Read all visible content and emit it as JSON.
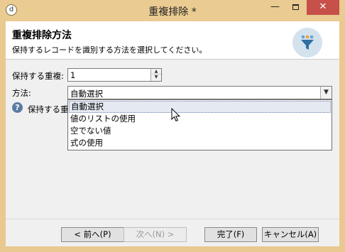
{
  "window": {
    "title": "重複排除 *",
    "app_icon": "d",
    "minimize_glyph": "—",
    "close_glyph": "✕",
    "accent_color": "#eacb91",
    "close_color": "#c7504a"
  },
  "header": {
    "title": "重複排除方法",
    "subtitle": "保持するレコードを識別する方法を選択してください。",
    "icon": "filter-funnel-icon"
  },
  "form": {
    "duplicates_label": "保持する重複:",
    "duplicates_value": "1",
    "method_label": "方法:",
    "method_value": "自動選択",
    "keep_label_partial": "保持する重",
    "help_icon": "?"
  },
  "dropdown": {
    "options": [
      "自動選択",
      "値のリストの使用",
      "空でない値",
      "式の使用"
    ],
    "selected_index": 0
  },
  "buttons": {
    "back": "< 前へ(P)",
    "next": "次へ(N) >",
    "finish": "完了(F)",
    "cancel": "キャンセル(A)"
  }
}
